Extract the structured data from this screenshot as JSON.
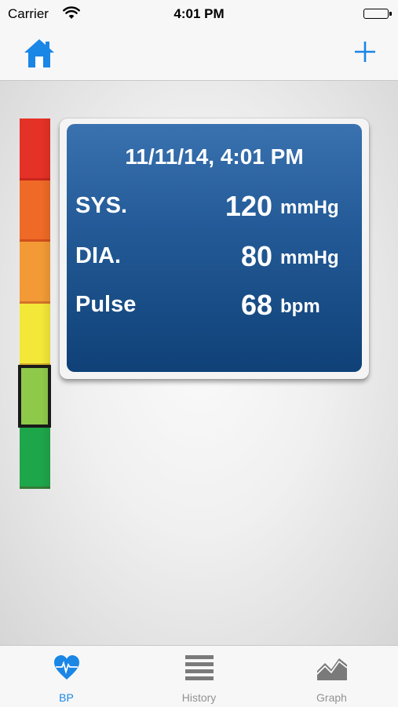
{
  "status_bar": {
    "carrier": "Carrier",
    "time": "4:01 PM"
  },
  "nav_bar": {
    "left_icon": "home-icon",
    "right_icon": "plus-icon",
    "accent_color": "#1a86e6"
  },
  "reading": {
    "datetime": "11/11/14, 4:01 PM",
    "rows": [
      {
        "label": "SYS.",
        "value": "120",
        "unit": "mmHg"
      },
      {
        "label": "DIA.",
        "value": "80",
        "unit": "mmHg"
      },
      {
        "label": "Pulse",
        "value": "68",
        "unit": "bpm"
      }
    ]
  },
  "scale": {
    "segment_colors": [
      "#e53226",
      "#ef6a26",
      "#f39a36",
      "#f3e838",
      "#8fc94a",
      "#1ea64a"
    ],
    "highlighted_segment_index": 4
  },
  "tab_bar": {
    "tabs": [
      {
        "label": "BP",
        "icon": "heart-pulse-icon",
        "active": true
      },
      {
        "label": "History",
        "icon": "list-icon",
        "active": false
      },
      {
        "label": "Graph",
        "icon": "area-chart-icon",
        "active": false
      }
    ]
  }
}
